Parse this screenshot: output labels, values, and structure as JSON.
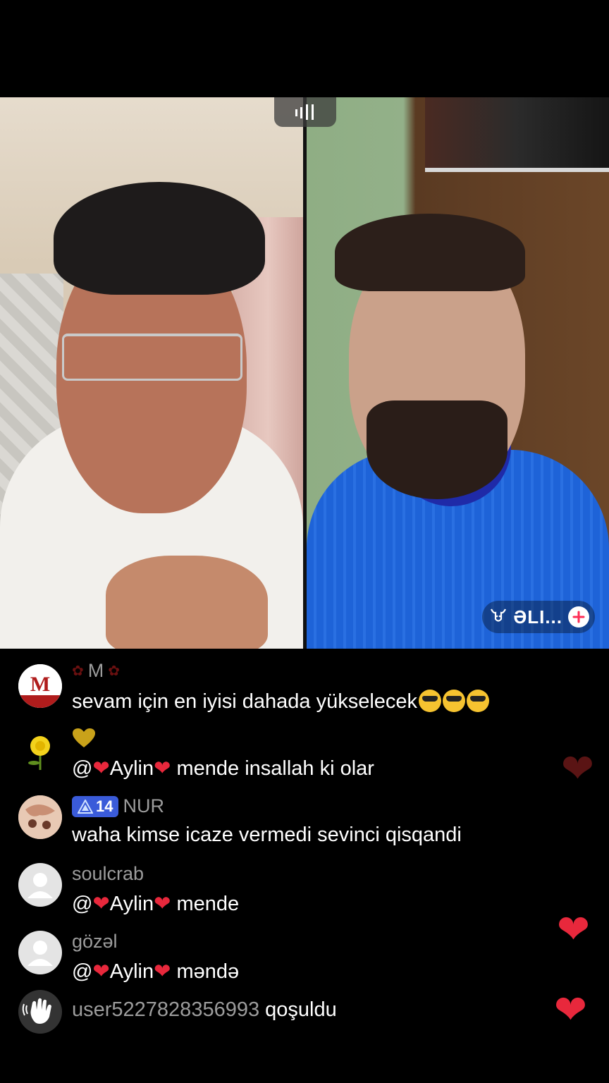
{
  "colors": {
    "accent_heart": "#e8283c",
    "level_badge": "#3a5bd9",
    "muted_text": "#9c9c9c"
  },
  "stream": {
    "layout_icon": "layout-switch-icon",
    "guest": {
      "name": "ƏLI...",
      "badge_icon": "bull-icon",
      "add_icon": "plus-icon"
    }
  },
  "chat": {
    "messages": [
      {
        "user": "M",
        "text": "sevam için en iyisi dahada yükselecek",
        "emoji": "smiling-face-with-sunglasses"
      },
      {
        "user_icon": "yellow-heart-icon",
        "mention": "@",
        "mention_name": "Aylin",
        "text": "mende insallah ki olar"
      },
      {
        "level": "14",
        "user": "NUR",
        "text": "waha kimse icaze vermedi  sevinci qisqandi"
      },
      {
        "user": "soulcrab",
        "mention": "@",
        "mention_name": "Aylin",
        "text": "mende"
      },
      {
        "user": "gözəl",
        "mention": "@",
        "mention_name": "Aylin",
        "text": "məndə"
      }
    ],
    "join": {
      "user": "user5227828356993",
      "text": "qoşuldu"
    }
  }
}
